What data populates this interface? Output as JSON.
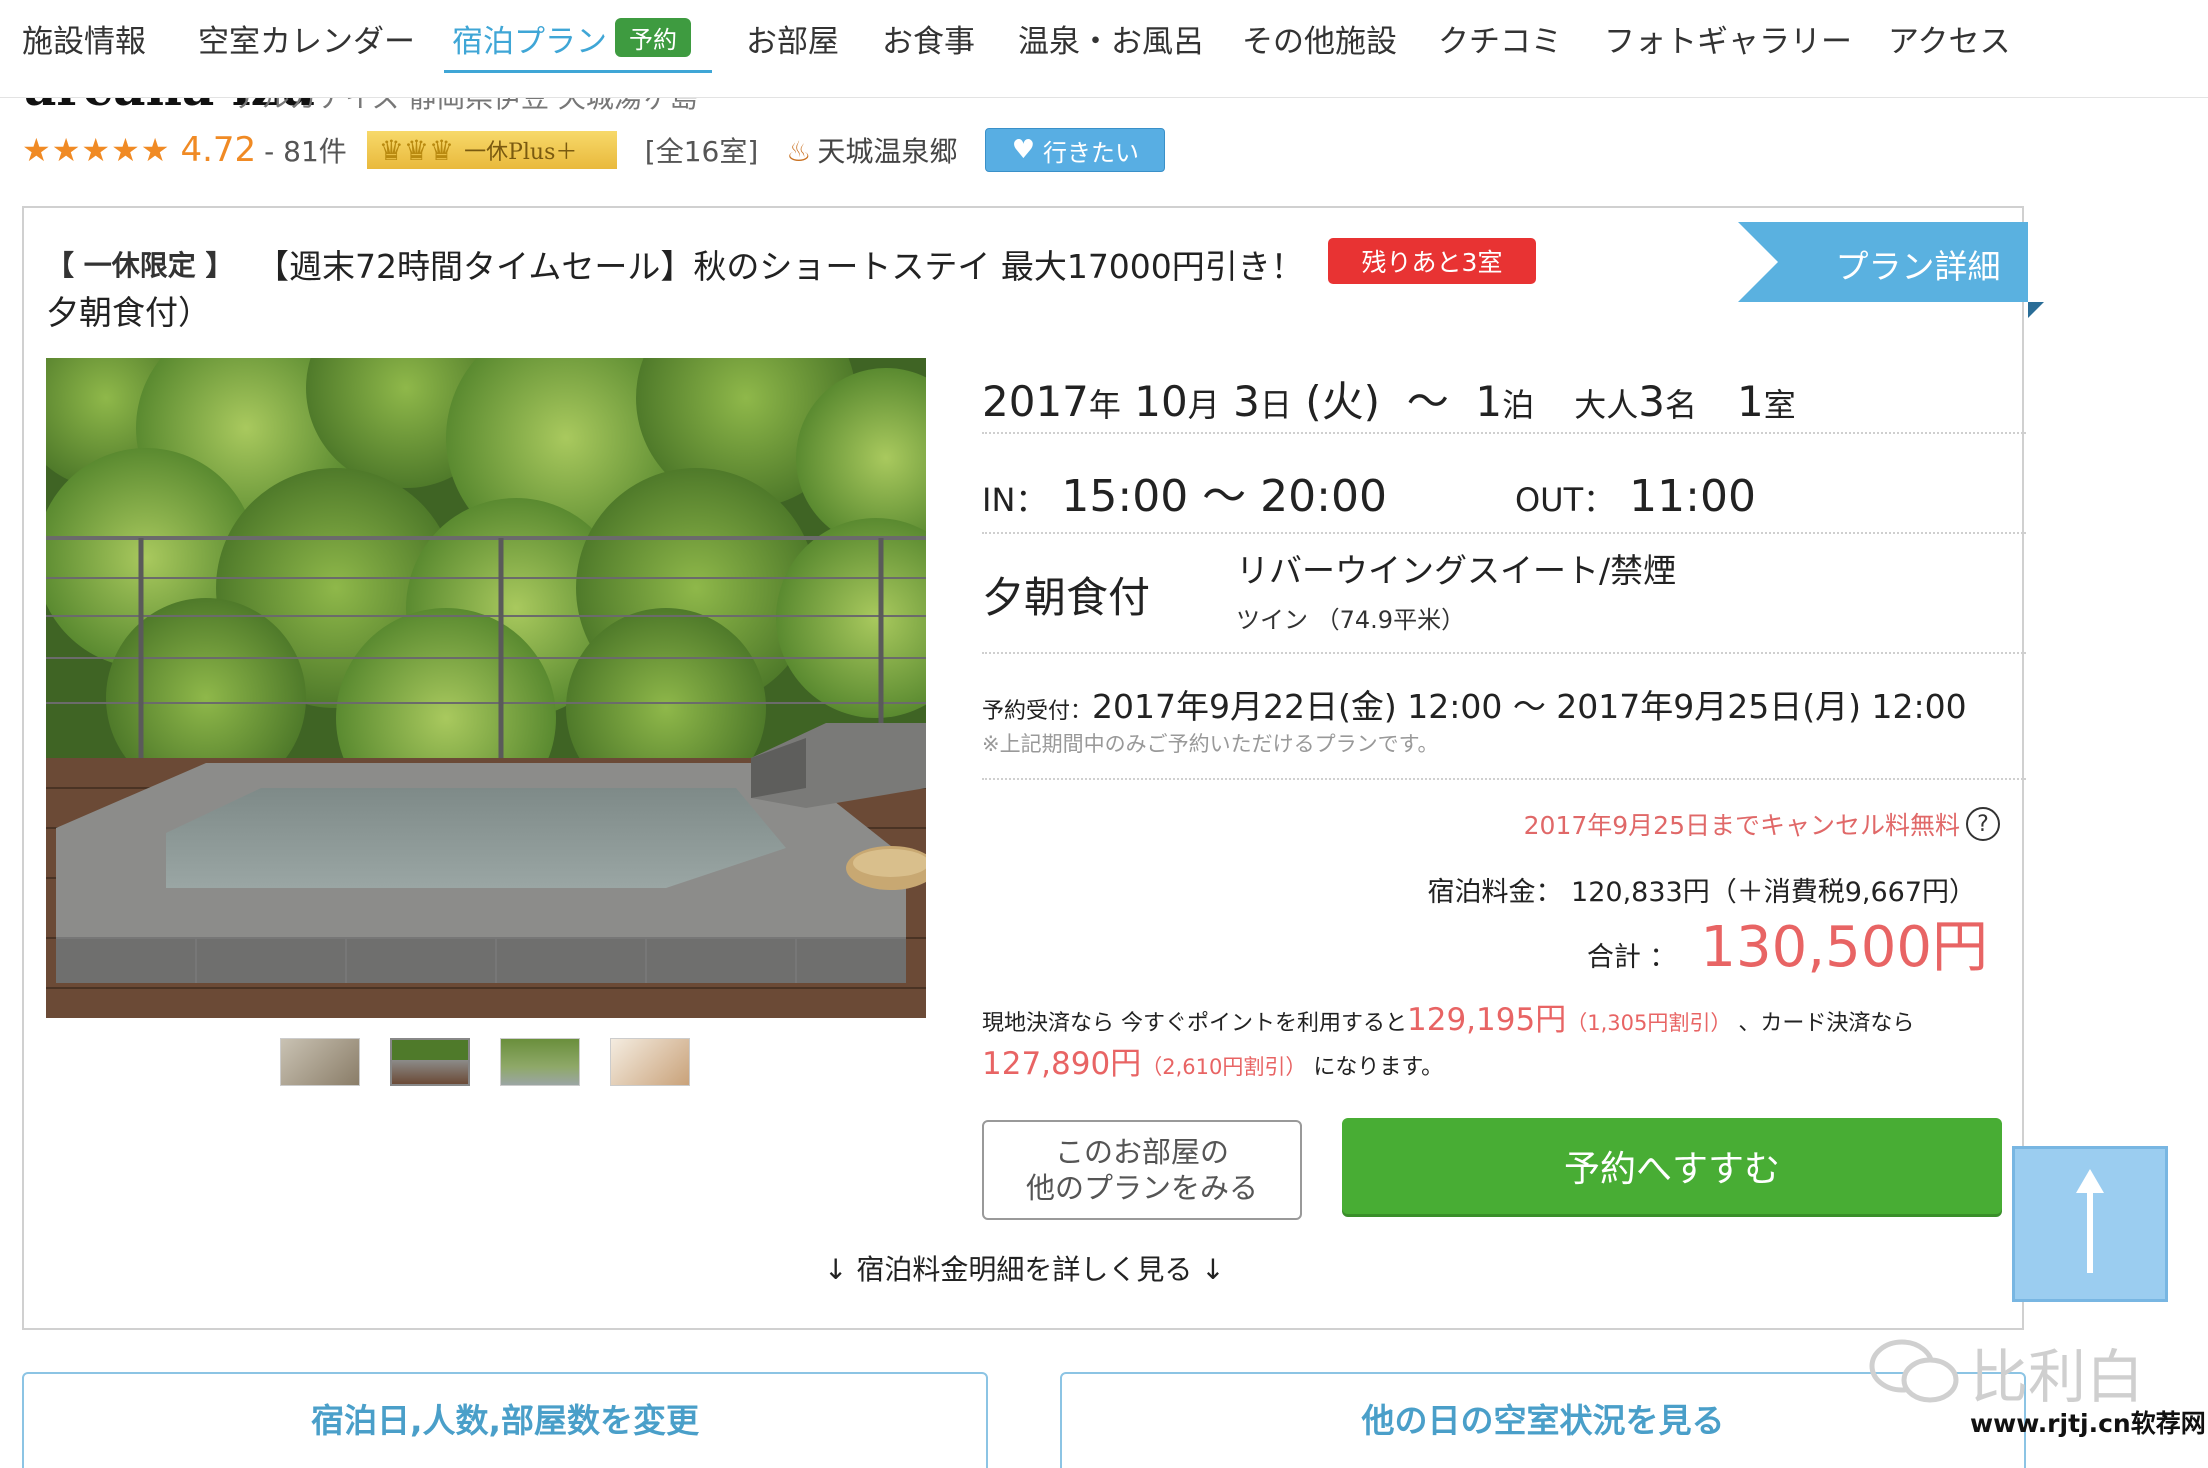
{
  "nav": {
    "items": [
      {
        "label": "施設情報"
      },
      {
        "label": "空室カレンダー"
      },
      {
        "label": "宿泊プラン",
        "badge": "予約"
      },
      {
        "label": "お部屋"
      },
      {
        "label": "お食事"
      },
      {
        "label": "温泉・お風呂"
      },
      {
        "label": "その他施設"
      },
      {
        "label": "クチコミ"
      },
      {
        "label": "フォトギャラリー"
      },
      {
        "label": "アクセス"
      }
    ],
    "active_index": 2,
    "accent_color": "#3fa6d6"
  },
  "hotel": {
    "name": "arcana izu",
    "address": "アルカナイズ 静岡県伊豆 天城湯ヶ島",
    "stars": "★★★★★",
    "rating": "4.72",
    "review_count": "- 81件",
    "plus_badge": "一休Plus＋",
    "rooms": "[全16室]",
    "onsen": "天城温泉郷",
    "wish_label": "行きたい"
  },
  "plan": {
    "limited_tag": "【 一休限定 】",
    "title_line1": "【週末72時間タイムセール】秋のショートステイ 最大17000円引き！",
    "title_line2": "夕朝食付）",
    "remaining": "残りあと3室",
    "detail_label": "プラン詳細",
    "stay": {
      "year": "2017",
      "year_unit": "年",
      "month": "10",
      "month_unit": "月",
      "day": "3",
      "day_unit": "日",
      "weekday": "(火)",
      "tilde": "～",
      "nights": "1",
      "nights_unit": "泊",
      "adults_label": "大人",
      "adults": "3",
      "adults_unit": "名",
      "rooms": "1",
      "rooms_unit": "室"
    },
    "checkin_label": "IN：",
    "checkin": "15:00 〜 20:00",
    "checkout_label": "OUT：",
    "checkout": "11:00",
    "meal": "夕朝食付",
    "room_name": "リバーウイングスイート/禁煙",
    "room_type": "ツイン （74.9平米）",
    "accept_label": "予約受付：",
    "accept_period": "2017年9月22日(金) 12:00 〜 2017年9月25日(月) 12:00",
    "accept_note": "※上記期間中のみご予約いただけるプランです。",
    "cancel_free": "2017年9月25日までキャンセル料無料",
    "help_icon": "?",
    "price_label": "宿泊料金：",
    "price_value": "120,833円（＋消費税9,667円）",
    "total_label": "合計 ：",
    "total_value": "130,500円",
    "points_text_1": "現地決済なら 今すぐポイントを利用すると",
    "points_price_1": "129,195円",
    "points_discount_1": "（1,305円割引）",
    "points_text_2": "、カード決済なら",
    "points_price_2": "127,890円",
    "points_discount_2": "（2,610円割引）",
    "points_text_3": "になります。",
    "other_plans_line1": "このお部屋の",
    "other_plans_line2": "他のプランをみる",
    "reserve_label": "予約へすすむ",
    "detail_link": "↓ 宿泊料金明細を詳しく見る ↓",
    "photo_count": 4,
    "selected_photo_index": 1
  },
  "bottom": {
    "change_label": "宿泊日,人数,部屋数を変更",
    "other_days_label": "他の日の空室状況を見る"
  },
  "watermark": {
    "brand": "比利白",
    "url": "www.rjtj.cn软荐网"
  },
  "icons": {
    "star": "star-icon",
    "crown": "crown-icon",
    "onsen": "hot-spring-icon",
    "heart": "heart-icon",
    "help": "question-icon",
    "scroll_top": "arrow-up-icon"
  },
  "colors": {
    "rating_orange": "#f08a24",
    "ribbon_blue": "#5ab1e0",
    "remain_red": "#e83333",
    "price_red": "#e86464",
    "reserve_green": "#48ad34",
    "wish_blue": "#58aee3"
  }
}
